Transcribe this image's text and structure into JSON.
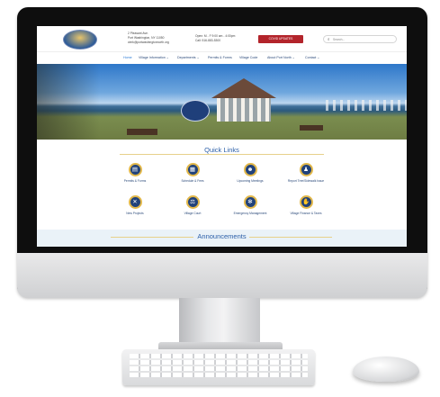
{
  "header": {
    "address_line1": "2 Pleasant Ave.",
    "address_line2": "Port Washington, NY 11050",
    "email": "clerk@portwashingtonnorth.org",
    "hours": "Open: M - F 9:00 am - 4:00pm",
    "phone": "Call: 516-883-5300",
    "covid_button": "COVID UPDATES",
    "search_placeholder": "Search..."
  },
  "nav": {
    "items": [
      {
        "label": "Home"
      },
      {
        "label": "Village Information ⌄"
      },
      {
        "label": "Departments ⌄"
      },
      {
        "label": "Permits & Forms"
      },
      {
        "label": "Village Code"
      },
      {
        "label": "About Port North ⌄"
      },
      {
        "label": "Contact ⌄"
      }
    ]
  },
  "quick_links": {
    "title": "Quick Links",
    "items": [
      {
        "label": "Permits & Forms",
        "icon": "document-icon"
      },
      {
        "label": "Schedule & Fees",
        "icon": "clipboard-icon"
      },
      {
        "label": "Upcoming Meetings",
        "icon": "people-icon"
      },
      {
        "label": "Report Tree/Sidewalk Issue",
        "icon": "bell-icon"
      },
      {
        "label": "New Projects",
        "icon": "tools-icon"
      },
      {
        "label": "Village Court",
        "icon": "scales-icon"
      },
      {
        "label": "Emergency Management",
        "icon": "gear-icon"
      },
      {
        "label": "Village Finance & Taxes",
        "icon": "hand-coin-icon"
      }
    ]
  },
  "announcements": {
    "title": "Announcements"
  },
  "colors": {
    "accent_navy": "#21427a",
    "accent_gold": "#e2b84a",
    "covid_red": "#b3242b",
    "link_blue": "#2b5ea8"
  }
}
